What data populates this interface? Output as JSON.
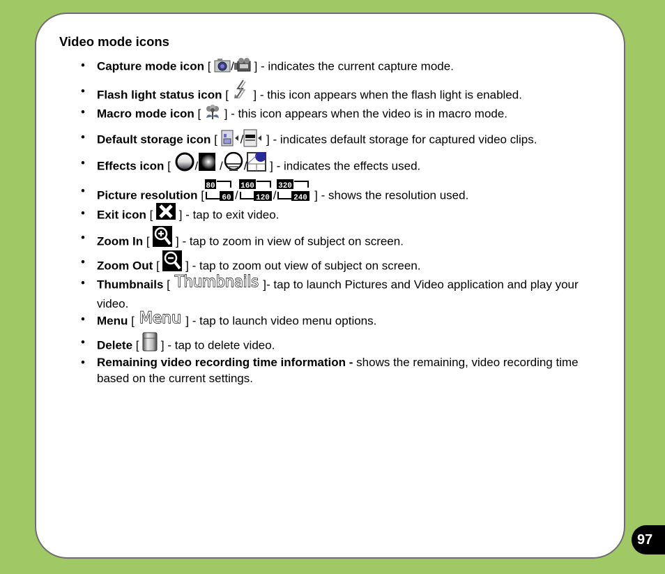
{
  "section": {
    "heading": "Video mode icons"
  },
  "items": [
    {
      "label": "Capture mode icon",
      "open": " [ ",
      "sep1": "/",
      "close": " ] ",
      "desc": "- indicates the current capture mode.",
      "icons": [
        "camera-icon",
        "video-camera-icon"
      ]
    },
    {
      "label": "Flash light status icon",
      "open": " [ ",
      "close": " ] ",
      "desc": "- this icon appears when the flash light is enabled.",
      "icons": [
        "flash-icon"
      ]
    },
    {
      "label": "Macro mode icon",
      "open": " [ ",
      "close": " ] ",
      "desc": "- this icon appears when the video is in macro mode.",
      "icons": [
        "macro-flower-icon"
      ]
    },
    {
      "label": "Default storage icon",
      "open": " [ ",
      "sep1": "/",
      "close": " ] ",
      "desc": "- indicates default storage for captured video clips.",
      "icons": [
        "storage-card-icon",
        "internal-memory-icon"
      ]
    },
    {
      "label": "Effects icon",
      "open": " [ ",
      "sep1": "/",
      "sep2": " /",
      "sep3": "/",
      "close": " ] ",
      "desc": "- indicates the effects used.",
      "icons": [
        "effect-normal-icon",
        "effect-mono-icon",
        "effect-negative-icon",
        "effect-sepia-icon"
      ]
    },
    {
      "label": "Picture resolution",
      "open": " [",
      "sep1": "/",
      "sep2": "/",
      "close": " ] ",
      "desc": "- shows the resolution used.",
      "icons": [
        "resolution-80x60-icon",
        "resolution-160x120-icon",
        "resolution-320x240-icon"
      ],
      "resolutions": [
        {
          "w": "80",
          "h": "60"
        },
        {
          "w": "160",
          "h": "120"
        },
        {
          "w": "320",
          "h": "240"
        }
      ]
    },
    {
      "label": "Exit icon",
      "open": " [ ",
      "close": " ] ",
      "desc": "- tap to exit video.",
      "icons": [
        "close-x-icon"
      ]
    },
    {
      "label": "Zoom In",
      "open": " [ ",
      "close": " ] ",
      "desc": "- tap to zoom in view of subject on screen.",
      "icons": [
        "zoom-in-icon"
      ]
    },
    {
      "label": "Zoom Out",
      "open": " [ ",
      "close": " ] ",
      "desc": "- tap to zoom out view of subject on screen.",
      "icons": [
        "zoom-out-icon"
      ]
    },
    {
      "label": "Thumbnails",
      "open": " [ ",
      "close": " ]",
      "desc": "- tap to launch Pictures and Video application and play your video.",
      "icons": [
        "thumbnails-button-icon"
      ],
      "icon_text": "Thumbnails"
    },
    {
      "label": "Menu",
      "open": " [ ",
      "close": " ] ",
      "desc": "- tap to launch video menu options.",
      "icons": [
        "menu-button-icon"
      ],
      "icon_text": "Menu"
    },
    {
      "label": "Delete",
      "open": " [ ",
      "close": " ] ",
      "desc": "- tap to delete video.",
      "icons": [
        "trash-can-icon"
      ]
    },
    {
      "label": "Remaining video recording time information",
      "open": "",
      "close": " - ",
      "desc": "shows the remaining, video recording time based on the current settings.",
      "icons": []
    }
  ],
  "bullet": "•",
  "page_number": "97",
  "colors": {
    "background_green": "#a0c864",
    "page_border": "#6e6e72",
    "page_badge": "#000000"
  }
}
